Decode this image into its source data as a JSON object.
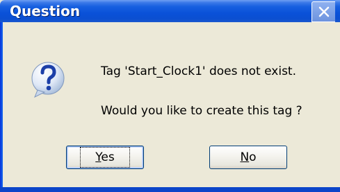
{
  "dialog": {
    "title": "Question",
    "message_line1": "Tag 'Start_Clock1' does not exist.",
    "message_line2": "Would you like to create this tag ?",
    "icon": "question-icon",
    "close_icon": "close-icon"
  },
  "buttons": {
    "yes": {
      "mnemonic": "Y",
      "rest": "es",
      "default": true
    },
    "no": {
      "mnemonic": "N",
      "rest": "o",
      "default": false
    }
  },
  "colors": {
    "titlebar": "#0a51d8",
    "dialog_bg": "#ece9d8",
    "button_border": "#003c74"
  }
}
